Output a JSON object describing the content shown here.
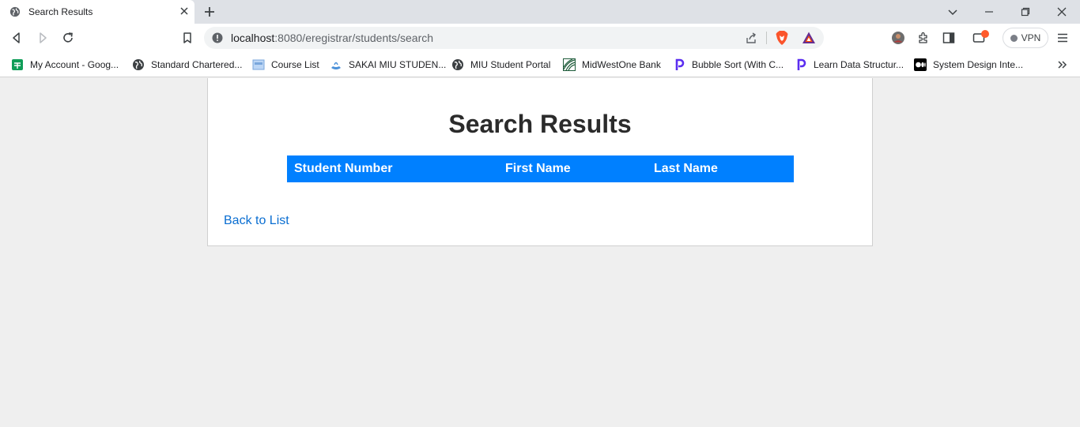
{
  "browser": {
    "tab": {
      "title": "Search Results"
    },
    "address_bar": {
      "host": "localhost",
      "path": ":8080/eregistrar/students/search"
    },
    "vpn_label": "VPN",
    "bookmarks": [
      {
        "label": "My Account - Goog...",
        "icon": "google-sheets-icon"
      },
      {
        "label": "Standard Chartered...",
        "icon": "globe-icon"
      },
      {
        "label": "Course List",
        "icon": "page-icon"
      },
      {
        "label": "SAKAI MIU STUDEN...",
        "icon": "sakai-icon"
      },
      {
        "label": "MIU Student Portal",
        "icon": "globe-icon"
      },
      {
        "label": "MidWestOne Bank",
        "icon": "bank-icon"
      },
      {
        "label": "Bubble Sort (With C...",
        "icon": "p-logo-icon"
      },
      {
        "label": "Learn Data Structur...",
        "icon": "p-logo-icon"
      },
      {
        "label": "System Design Inte...",
        "icon": "medium-icon"
      }
    ]
  },
  "page": {
    "title": "Search Results",
    "table": {
      "columns": [
        "Student Number",
        "First Name",
        "Last Name"
      ],
      "rows": []
    },
    "back_link": "Back to List"
  },
  "colors": {
    "table_header_bg": "#0080ff",
    "link": "#0a6ed1",
    "page_bg": "#efefef"
  }
}
